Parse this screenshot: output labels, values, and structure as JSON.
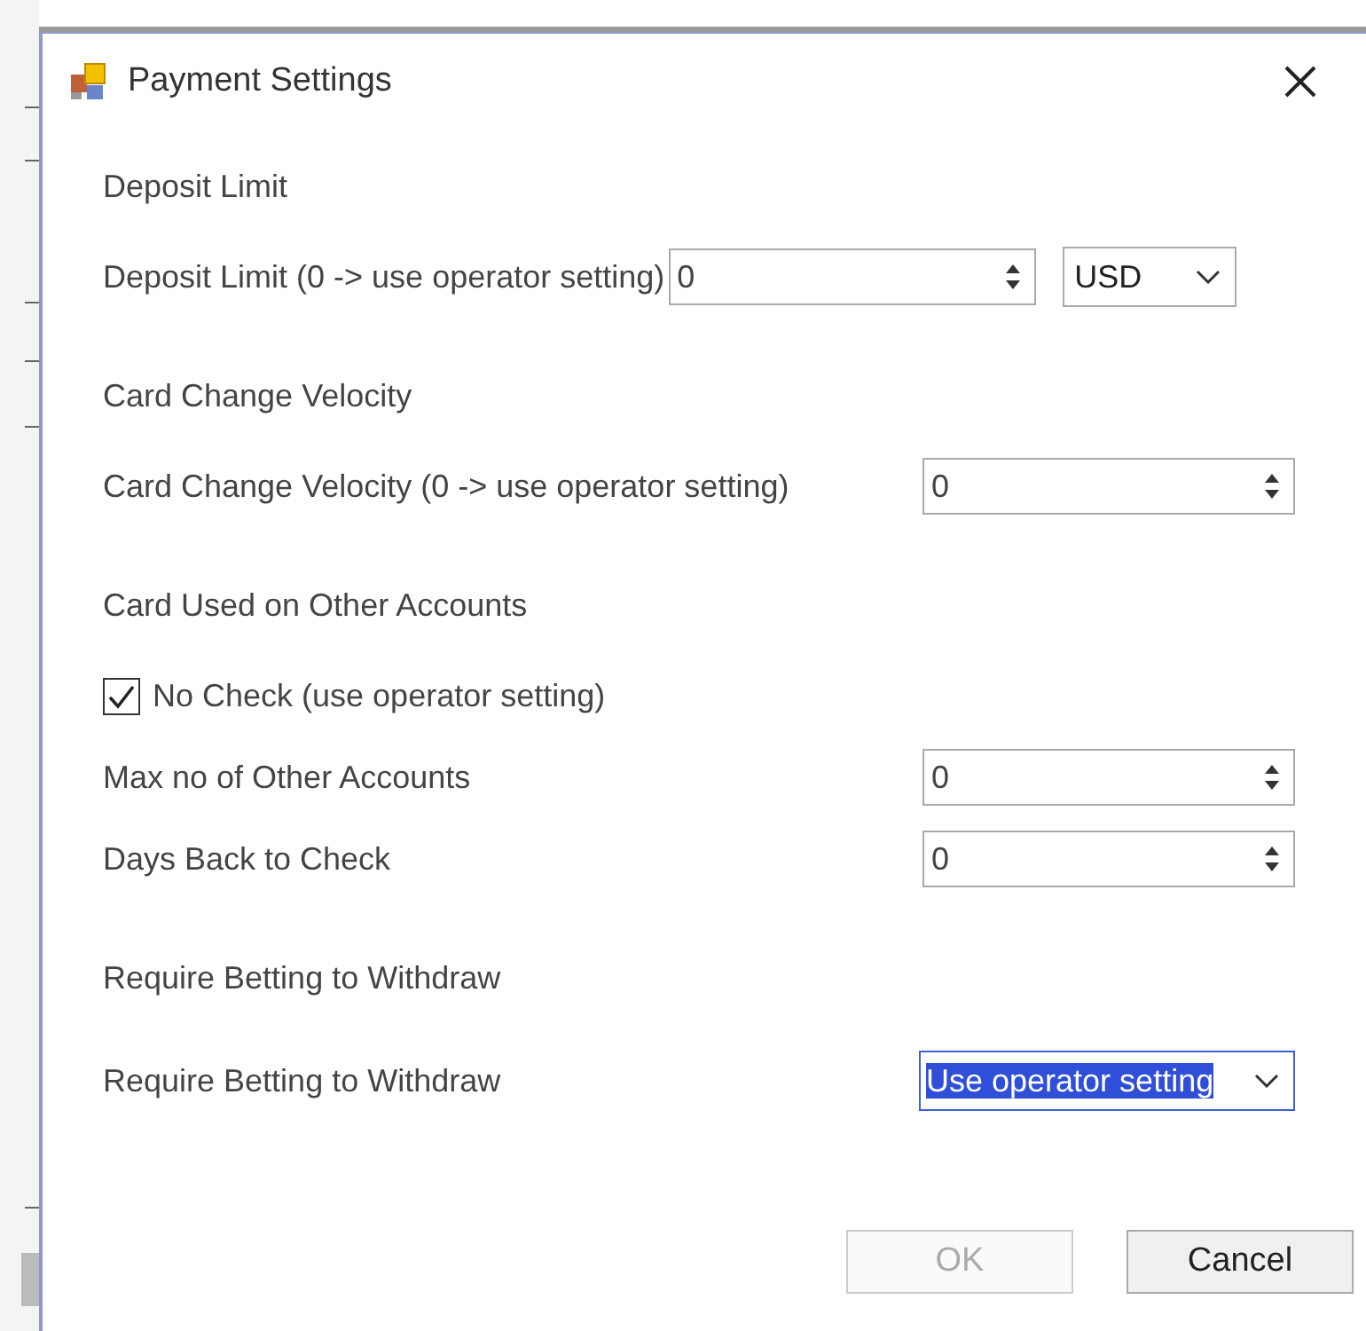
{
  "window": {
    "title": "Payment Settings"
  },
  "rows": [
    {
      "kind": "heading",
      "label": "Deposit Limit"
    },
    {
      "kind": "spin_currency",
      "label": "Deposit Limit (0 -> use operator setting)",
      "value": "0",
      "currency": "USD"
    },
    {
      "kind": "heading",
      "label": "Card Change Velocity"
    },
    {
      "kind": "spin",
      "label": "Card Change Velocity (0 -> use operator setting)",
      "value": "0"
    },
    {
      "kind": "heading",
      "label": "Card Used on Other Accounts"
    },
    {
      "kind": "checkbox",
      "label": "No Check (use operator setting)",
      "checked": true
    },
    {
      "kind": "spin",
      "label": "Max no of Other Accounts",
      "value": "0"
    },
    {
      "kind": "spin",
      "label": "Days Back to Check",
      "value": "0"
    },
    {
      "kind": "heading",
      "label": "Require Betting to Withdraw"
    },
    {
      "kind": "select",
      "label": "Require Betting to Withdraw",
      "value": "Use operator setting",
      "focused": true
    }
  ],
  "buttons": [
    {
      "label": "OK",
      "disabled": true
    },
    {
      "label": "Cancel",
      "disabled": false
    }
  ]
}
